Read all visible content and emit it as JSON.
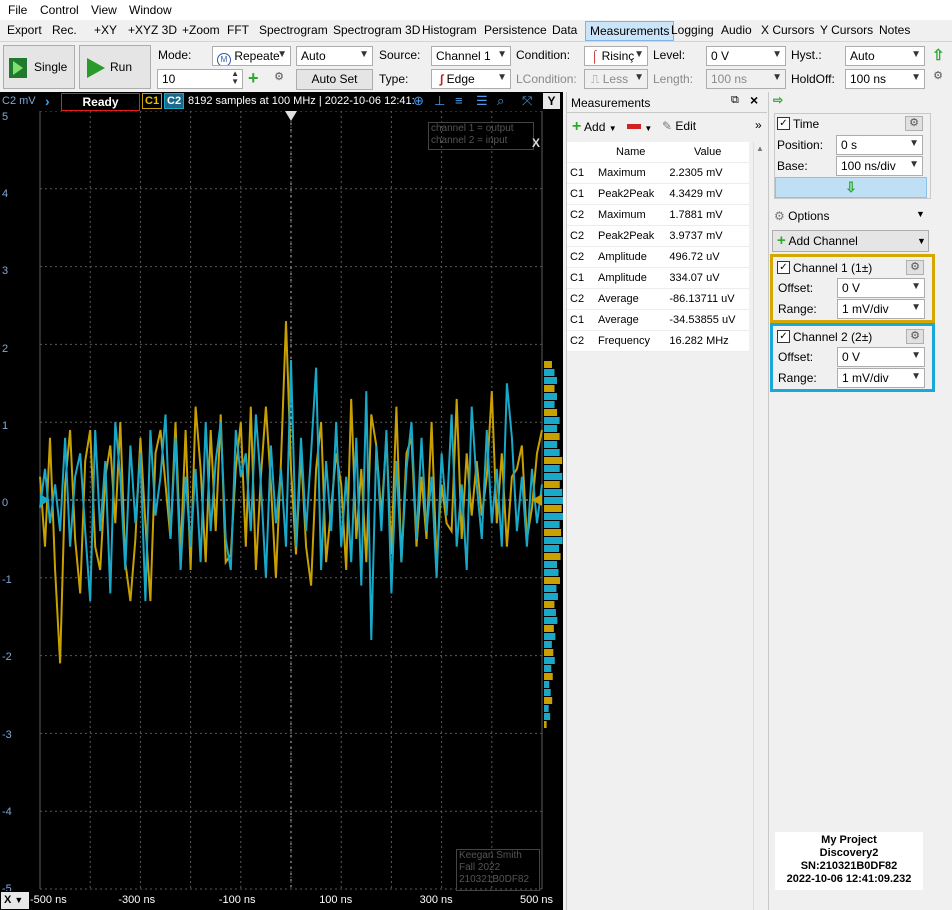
{
  "menu": [
    "File",
    "Control",
    "View",
    "Window"
  ],
  "tabs": [
    "Export",
    "Rec.",
    "+XY",
    "+XYZ 3D",
    "+Zoom",
    "FFT",
    "Spectrogram",
    "Spectrogram 3D",
    "Histogram",
    "Persistence",
    "Data",
    "Measurements",
    "Logging",
    "Audio",
    "X Cursors",
    "Y Cursors",
    "Notes"
  ],
  "active_tab": "Measurements",
  "toolbar": {
    "single_label": "Single",
    "run_label": "Run",
    "mode_label": "Mode:",
    "mode_value": "Repeate",
    "mode_auto": "Auto",
    "count_value": "10",
    "autoset_label": "Auto Set",
    "source_label": "Source:",
    "source_value": "Channel 1",
    "type_label": "Type:",
    "type_value": "Edge",
    "condition_label": "Condition:",
    "condition_value": "Risinç",
    "lcondition_label": "LCondition:",
    "lcondition_value": "Less",
    "level_label": "Level:",
    "level_value": "0 V",
    "length_label": "Length:",
    "length_value": "100 ns",
    "hyst_label": "Hyst.:",
    "hyst_value": "Auto",
    "holdoff_label": "HoldOff:",
    "holdoff_value": "100 ns"
  },
  "scope": {
    "axis_unit": "C2 mV",
    "status": "Ready",
    "c1": "C1",
    "c2": "C2",
    "info": "8192 samples at 100 MHz | 2022-10-06 12:41:",
    "y_button": "Y",
    "y_ticks": [
      "5",
      "4",
      "3",
      "2",
      "1",
      "0",
      "-1",
      "-2",
      "-3",
      "-4",
      "-5"
    ],
    "x_ticks": [
      "-500 ns",
      "-300 ns",
      "-100 ns",
      "100 ns",
      "300 ns",
      "500 ns"
    ],
    "x_button": "X",
    "note_lines": [
      "channel 1 = output",
      "channel 2 = input"
    ],
    "note_close": "X",
    "signature_lines": [
      "Keegan Smith",
      "Fall 2022",
      "210321B0DF82"
    ],
    "colors": {
      "c1": "#c8a000",
      "c2": "#1aa8c8",
      "grid": "#5a5a5a",
      "label": "#7fa8d8"
    }
  },
  "measurements": {
    "title": "Measurements",
    "add_label": "Add",
    "edit_label": "Edit",
    "headers": [
      "Name",
      "Value"
    ],
    "rows": [
      [
        "C1",
        "Maximum",
        "2.2305 mV"
      ],
      [
        "C1",
        "Peak2Peak",
        "4.3429 mV"
      ],
      [
        "C2",
        "Maximum",
        "1.7881 mV"
      ],
      [
        "C2",
        "Peak2Peak",
        "3.9737 mV"
      ],
      [
        "C2",
        "Amplitude",
        "496.72 uV"
      ],
      [
        "C1",
        "Amplitude",
        "334.07 uV"
      ],
      [
        "C2",
        "Average",
        "-86.13711 uV"
      ],
      [
        "C1",
        "Average",
        "-34.53855 uV"
      ],
      [
        "C2",
        "Frequency",
        "16.282 MHz"
      ]
    ]
  },
  "right": {
    "time_label": "Time",
    "position_label": "Position:",
    "position_value": "0 s",
    "base_label": "Base:",
    "base_value": "100 ns/div",
    "options_label": "Options",
    "add_channel_label": "Add Channel",
    "ch1_label": "Channel 1 (1±)",
    "ch1_offset_label": "Offset:",
    "ch1_offset_value": "0 V",
    "ch1_range_label": "Range:",
    "ch1_range_value": "1 mV/div",
    "ch2_label": "Channel 2 (2±)",
    "ch2_offset_label": "Offset:",
    "ch2_offset_value": "0 V",
    "ch2_range_label": "Range:",
    "ch2_range_value": "1 mV/div",
    "device_lines": [
      "My Project",
      "Discovery2",
      "SN:210321B0DF82",
      "2022-10-06 12:41:09.232"
    ]
  },
  "chart_data": {
    "type": "line",
    "xlabel": "",
    "ylabel": "C2 mV",
    "xlim": [
      -500,
      500
    ],
    "ylim": [
      -5,
      5
    ],
    "grid": true,
    "series": [
      {
        "name": "C1",
        "color": "#c8a000",
        "x": [
          -500,
          -490,
          -480,
          -470,
          -460,
          -450,
          -440,
          -430,
          -420,
          -410,
          -400,
          -390,
          -380,
          -370,
          -360,
          -350,
          -340,
          -330,
          -320,
          -310,
          -300,
          -290,
          -280,
          -270,
          -260,
          -250,
          -240,
          -230,
          -220,
          -210,
          -200,
          -190,
          -180,
          -170,
          -160,
          -150,
          -140,
          -130,
          -120,
          -110,
          -100,
          -90,
          -80,
          -70,
          -60,
          -50,
          -40,
          -30,
          -20,
          -10,
          0,
          10,
          20,
          30,
          40,
          50,
          60,
          70,
          80,
          90,
          100,
          110,
          120,
          130,
          140,
          150,
          160,
          170,
          180,
          190,
          200,
          210,
          220,
          230,
          240,
          250,
          260,
          270,
          280,
          290,
          300,
          310,
          320,
          330,
          340,
          350,
          360,
          370,
          380,
          390,
          400,
          410,
          420,
          430,
          440,
          450,
          460,
          470,
          480,
          490,
          500
        ],
        "y": [
          0.3,
          -0.6,
          0.8,
          -0.9,
          -2.1,
          0.2,
          0.9,
          -0.5,
          -1.2,
          0.5,
          0.9,
          -0.6,
          -0.9,
          0.3,
          0.7,
          -0.3,
          1.0,
          -0.8,
          -1.3,
          -0.5,
          0.8,
          -0.3,
          -1.3,
          0.6,
          0.9,
          0.2,
          -0.5,
          1.0,
          -0.7,
          0.9,
          -0.9,
          1.2,
          0.4,
          -0.8,
          0.9,
          -0.4,
          1.1,
          -0.8,
          -0.7,
          0.4,
          1.0,
          -0.6,
          1.2,
          -0.9,
          0.3,
          1.2,
          0.2,
          -1.0,
          0.5,
          2.3,
          0.4,
          -0.7,
          0.6,
          -0.6,
          -1.1,
          0.4,
          1.0,
          -0.8,
          -0.1,
          0.6,
          0.2,
          -0.9,
          1.3,
          -0.5,
          0.4,
          -0.8,
          1.1,
          0.7,
          -0.2,
          0.8,
          -0.7,
          1.2,
          -0.8,
          0.6,
          0.8,
          -0.6,
          0.3,
          -0.5,
          1.0,
          -0.8,
          0.2,
          -0.3,
          -0.4,
          1.3,
          -0.5,
          0.6,
          -0.2,
          0.5,
          -0.2,
          0.3,
          1.4,
          -0.3,
          0.6,
          -0.6,
          0.3,
          0.4,
          0.7,
          -0.5,
          -0.1,
          0.6,
          0.9
        ]
      },
      {
        "name": "C2",
        "color": "#1aa8c8",
        "x": [
          -500,
          -490,
          -480,
          -470,
          -460,
          -450,
          -440,
          -430,
          -420,
          -410,
          -400,
          -390,
          -380,
          -370,
          -360,
          -350,
          -340,
          -330,
          -320,
          -310,
          -300,
          -290,
          -280,
          -270,
          -260,
          -250,
          -240,
          -230,
          -220,
          -210,
          -200,
          -190,
          -180,
          -170,
          -160,
          -150,
          -140,
          -130,
          -120,
          -110,
          -100,
          -90,
          -80,
          -70,
          -60,
          -50,
          -40,
          -30,
          -20,
          -10,
          0,
          10,
          20,
          30,
          40,
          50,
          60,
          70,
          80,
          90,
          100,
          110,
          120,
          130,
          140,
          150,
          160,
          170,
          180,
          190,
          200,
          210,
          220,
          230,
          240,
          250,
          260,
          270,
          280,
          290,
          300,
          310,
          320,
          330,
          340,
          350,
          360,
          370,
          380,
          390,
          400,
          410,
          420,
          430,
          440,
          450,
          460,
          470,
          480,
          490,
          500
        ],
        "y": [
          -0.1,
          0.4,
          -0.3,
          0.2,
          -0.4,
          0.8,
          -0.6,
          0.3,
          0.6,
          -0.4,
          -1.3,
          0.9,
          -0.4,
          0.5,
          -1.2,
          1.0,
          0.3,
          -0.9,
          0.7,
          -0.3,
          0.6,
          -1.3,
          0.9,
          -0.2,
          0.3,
          1.1,
          -0.5,
          0.8,
          -0.9,
          0.3,
          -0.6,
          0.4,
          -0.8,
          1.0,
          -0.4,
          0.5,
          1.0,
          -0.5,
          -0.9,
          0.9,
          0.3,
          0.6,
          -0.4,
          1.1,
          0.2,
          -1.0,
          0.7,
          -0.3,
          0.4,
          -0.6,
          1.8,
          -0.6,
          0.8,
          -0.4,
          0.6,
          1.7,
          -0.9,
          0.5,
          -0.4,
          1.0,
          -0.6,
          0.3,
          -0.8,
          0.8,
          -1.1,
          1.4,
          -1.8,
          0.7,
          -0.4,
          0.9,
          -1.2,
          0.5,
          -0.8,
          0.4,
          1.0,
          -0.5,
          0.8,
          -0.4,
          0.3,
          -1.0,
          0.6,
          -0.2,
          1.1,
          -0.6,
          0.2,
          -0.9,
          1.2,
          0.2,
          -0.5,
          0.9,
          -0.3,
          0.4,
          -0.6,
          1.5,
          0.8,
          -0.4,
          0.3,
          -0.6,
          0.4,
          -0.3,
          0.2
        ]
      }
    ]
  }
}
